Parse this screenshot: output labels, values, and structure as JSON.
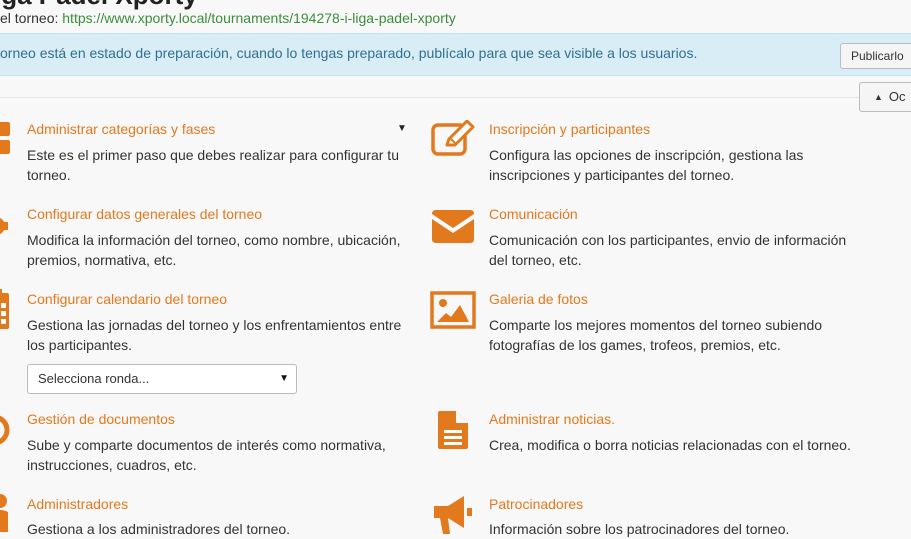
{
  "header": {
    "title": "iga Padel Xporty",
    "url_label": "el torneo: ",
    "url": "https://www.xporty.local/tournaments/194278-i-liga-padel-xporty"
  },
  "notice": {
    "text": "orneo está en estado de preparación, cuando lo tengas preparado, publícalo para que sea visible a los usuarios.",
    "publish_label": "Publicarlo"
  },
  "hide_button": {
    "label": "Oc",
    "icon": "triangle-up-icon"
  },
  "left_items": [
    {
      "title": "Administrar categorías y fases",
      "desc": "Este es el primer paso que debes realizar para configurar tu torneo.",
      "icon": "categories-icon"
    },
    {
      "title": "Configurar datos generales del torneo",
      "desc": "Modifica la información del torneo, como nombre, ubicación, premios, normativa, etc.",
      "icon": "gear-icon"
    },
    {
      "title": "Configurar calendario del torneo",
      "desc": "Gestiona las jornadas del torneo y los enfrentamientos entre los participantes.",
      "icon": "calendar-icon"
    },
    {
      "title": "Gestión de documentos",
      "desc": "Sube y comparte documentos de interés como normativa, instrucciones, cuadros, etc.",
      "icon": "documents-icon"
    },
    {
      "title": "Administradores",
      "desc": "Gestiona a los administradores del torneo.",
      "icon": "users-icon"
    }
  ],
  "round_select": {
    "value": "Selecciona ronda..."
  },
  "right_items": [
    {
      "title": "Inscripción y participantes",
      "desc": "Configura las opciones de inscripción, gestiona las inscripciones y participantes del torneo.",
      "icon": "edit-icon"
    },
    {
      "title": "Comunicación",
      "desc": "Comunicación con los participantes, envio de información del torneo, etc.",
      "icon": "envelope-icon"
    },
    {
      "title": "Galeria de fotos",
      "desc": "Comparte los mejores momentos del torneo subiendo fotografías de los games, trofeos, premios, etc.",
      "icon": "picture-icon"
    },
    {
      "title": "Administrar noticias.",
      "desc": "Crea, modifica o borra noticias relacionadas con el torneo.",
      "icon": "file-icon"
    },
    {
      "title": "Patrocinadores",
      "desc": "Información sobre los patrocinadores del torneo.",
      "icon": "megaphone-icon"
    }
  ],
  "colors": {
    "accent": "#e3791d",
    "notice_bg": "#d9edf7",
    "notice_text": "#31708f",
    "link": "#3c8d3c"
  }
}
